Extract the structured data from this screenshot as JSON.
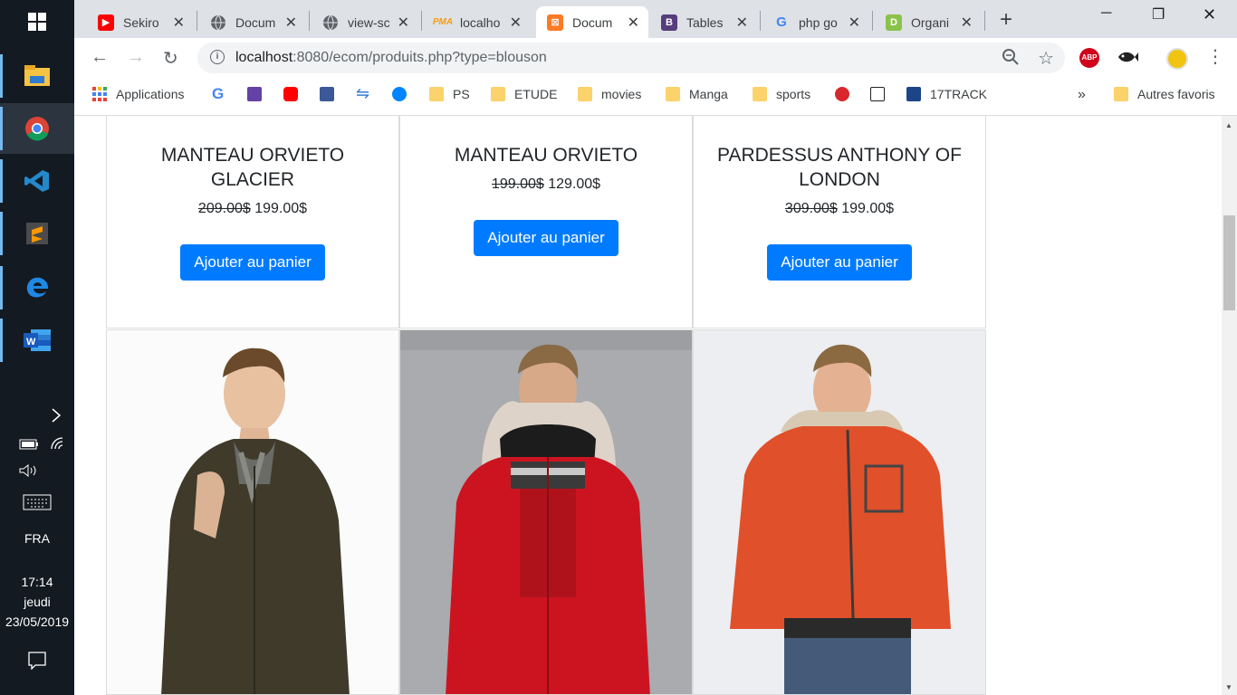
{
  "browser": {
    "tabs": [
      {
        "label": "Sekiro",
        "icon": "youtube-icon",
        "color": "#ff0000"
      },
      {
        "label": "Docum",
        "icon": "globe-icon",
        "color": "#5f6368"
      },
      {
        "label": "view-sc",
        "icon": "globe-icon",
        "color": "#5f6368"
      },
      {
        "label": "localho",
        "icon": "phpmyadmin-icon",
        "color": "#f89c0e"
      },
      {
        "label": "Docum",
        "icon": "xampp-icon",
        "color": "#fb7a24"
      },
      {
        "label": "Tables",
        "icon": "bootstrap-icon",
        "color": "#563d7c"
      },
      {
        "label": "php go",
        "icon": "google-icon",
        "color": "#4285f4"
      },
      {
        "label": "Organi",
        "icon": "organizer-icon",
        "color": "#8bc34a"
      }
    ],
    "url_host": "localhost",
    "url_rest": ":8080/ecom/produits.php?type=blouson",
    "bookmarks": {
      "apps": "Applications",
      "ps": "PS",
      "etude": "ETUDE",
      "movies": "movies",
      "manga": "Manga",
      "sports": "sports",
      "track": "17TRACK",
      "others": "Autres favoris"
    },
    "extensions": {
      "abp": "ABP"
    }
  },
  "taskbar": {
    "lang": "FRA",
    "time": "17:14",
    "day": "jeudi",
    "date": "23/05/2019"
  },
  "products": [
    {
      "name": "MANTEAU ORVIETO GLACIER",
      "old_price": "209.00$",
      "price": "199.00$",
      "button": "Ajouter au panier"
    },
    {
      "name": "MANTEAU ORVIETO",
      "old_price": "199.00$",
      "price": "129.00$",
      "button": "Ajouter au panier"
    },
    {
      "name": "PARDESSUS ANTHONY OF LONDON",
      "old_price": "309.00$",
      "price": "199.00$",
      "button": "Ajouter au panier"
    }
  ]
}
